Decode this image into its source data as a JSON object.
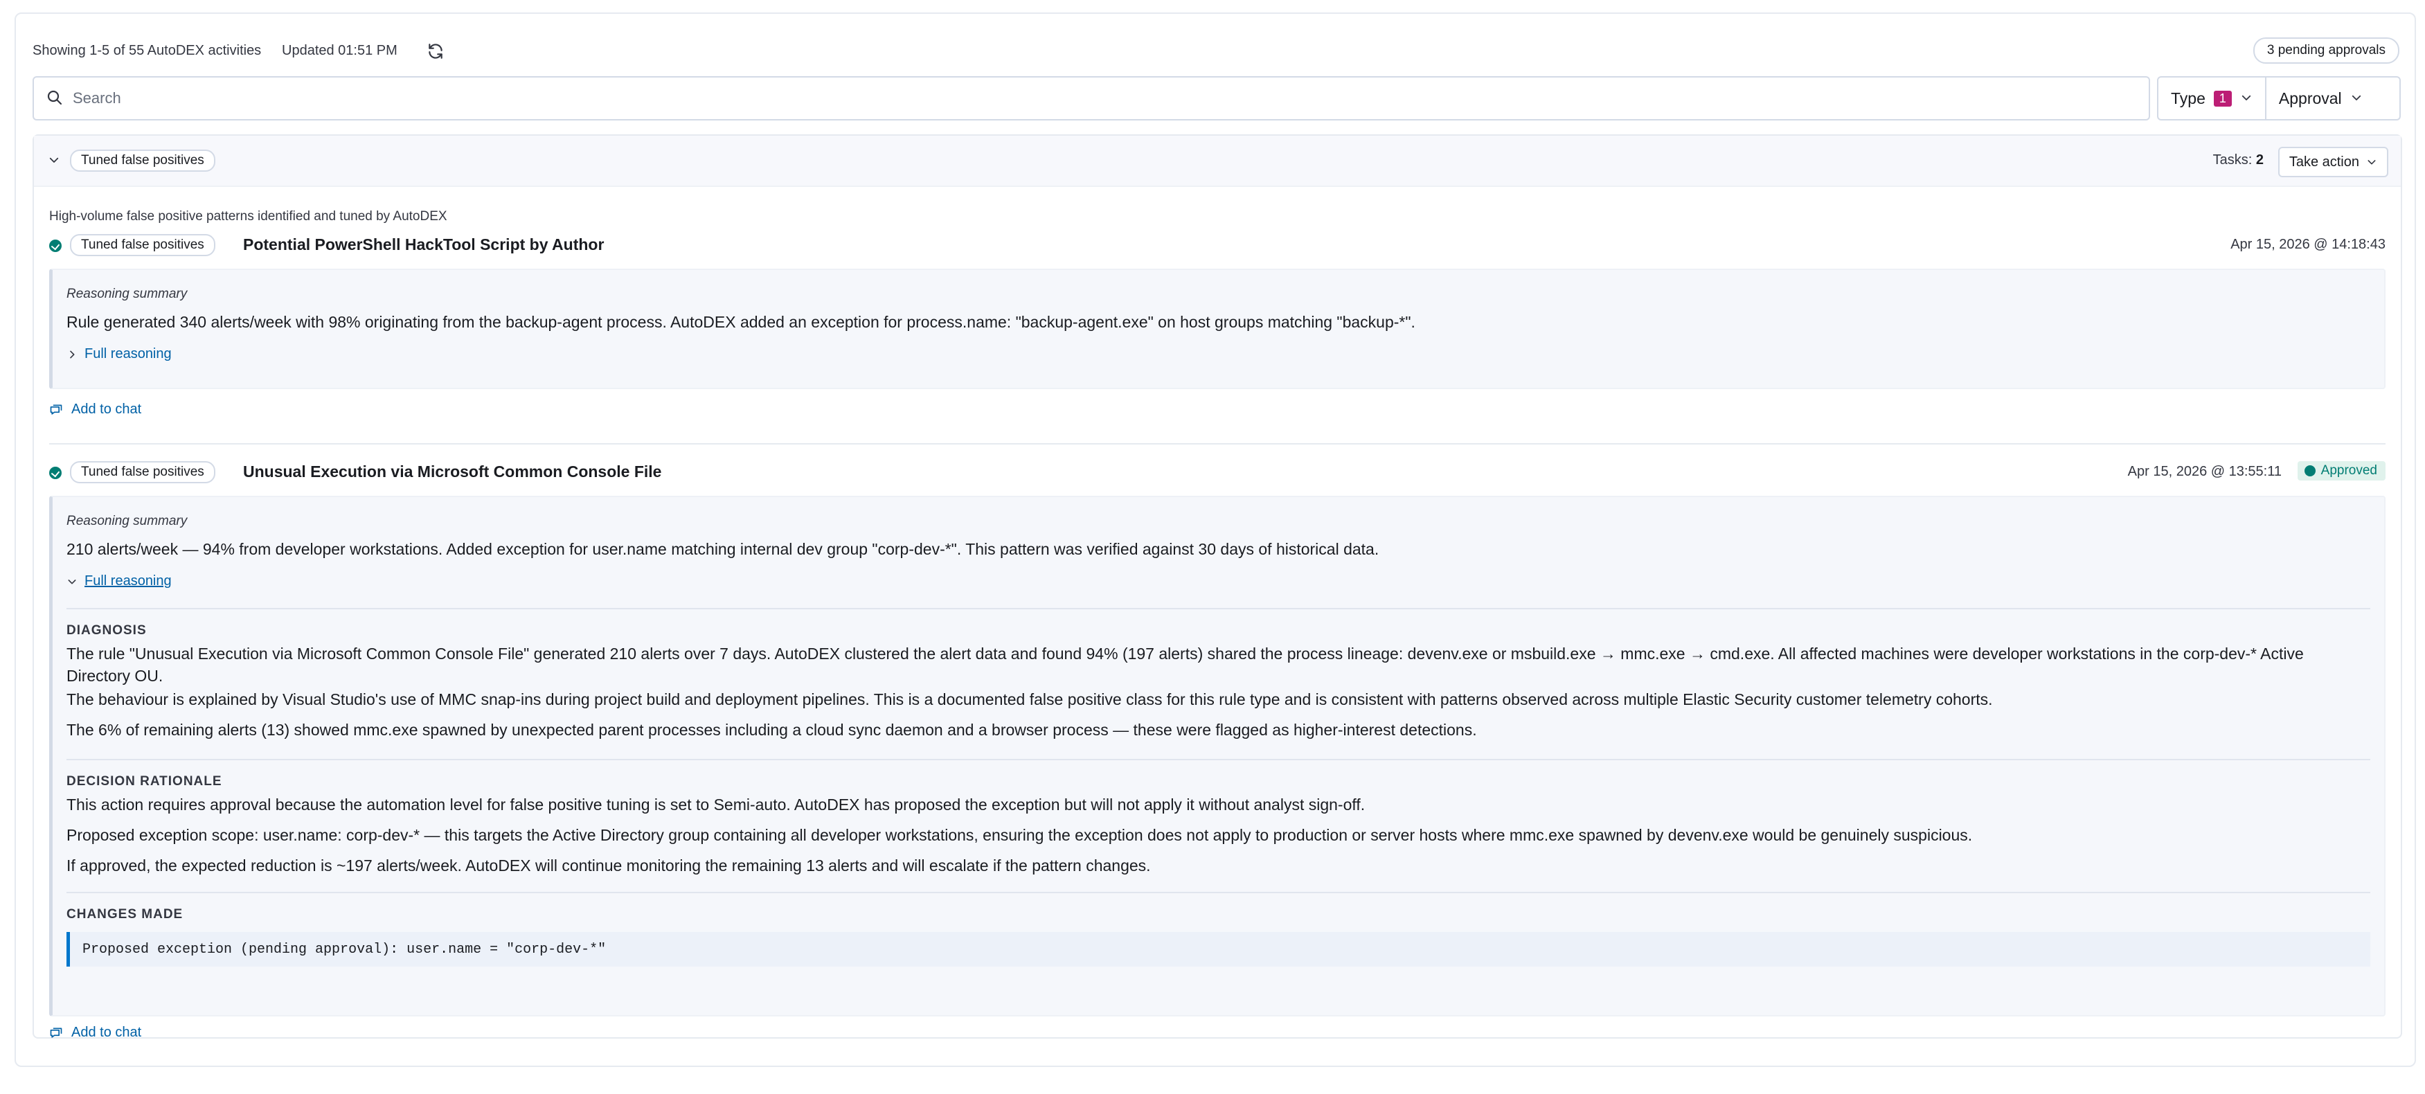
{
  "toolbar": {
    "count_text": "Showing 1-5 of 55 AutoDEX activities",
    "updated_text": "Updated 01:51 PM",
    "pending_text": "3 pending approvals"
  },
  "search": {
    "placeholder": "Search",
    "value": ""
  },
  "filters": {
    "type_label": "Type",
    "type_count": "1",
    "approval_label": "Approval"
  },
  "group": {
    "label": "Tuned false positives",
    "tasks_label": "Tasks:",
    "tasks_count": "2",
    "take_action_label": "Take action",
    "description": "High-volume false positive patterns identified and tuned by AutoDEX"
  },
  "items": [
    {
      "tag": "Tuned false positives",
      "title": "Potential PowerShell HackTool Script by Author",
      "timestamp": "Apr 15, 2026 @ 14:18:43",
      "reasoning_label": "Reasoning summary",
      "reasoning_text": "Rule generated 340 alerts/week with 98% originating from the backup-agent process. AutoDEX added an exception for process.name: \"backup-agent.exe\" on host groups matching \"backup-*\".",
      "full_reasoning_label": "Full reasoning",
      "add_to_chat_label": "Add to chat"
    },
    {
      "tag": "Tuned false positives",
      "title": "Unusual Execution via Microsoft Common Console File",
      "timestamp": "Apr 15, 2026 @ 13:55:11",
      "status": "Approved",
      "reasoning_label": "Reasoning summary",
      "reasoning_text": "210 alerts/week — 94% from developer workstations. Added exception for user.name matching internal dev group \"corp-dev-*\". This pattern was verified against 30 days of historical data.",
      "full_reasoning_label": "Full reasoning",
      "diagnosis_title": "DIAGNOSIS",
      "diagnosis": [
        "The rule \"Unusual Execution via Microsoft Common Console File\" generated 210 alerts over 7 days. AutoDEX clustered the alert data and found 94% (197 alerts) shared the process lineage: devenv.exe or msbuild.exe → mmc.exe → cmd.exe. All affected machines were developer workstations in the corp-dev-* Active Directory OU.",
        "The behaviour is explained by Visual Studio's use of MMC snap-ins during project build and deployment pipelines. This is a documented false positive class for this rule type and is consistent with patterns observed across multiple Elastic Security customer telemetry cohorts.",
        "The 6% of remaining alerts (13) showed mmc.exe spawned by unexpected parent processes including a cloud sync daemon and a browser process — these were flagged as higher-interest detections."
      ],
      "rationale_title": "DECISION RATIONALE",
      "rationale": [
        "This action requires approval because the automation level for false positive tuning is set to Semi-auto. AutoDEX has proposed the exception but will not apply it without analyst sign-off.",
        "Proposed exception scope: user.name: corp-dev-* — this targets the Active Directory group containing all developer workstations, ensuring the exception does not apply to production or server hosts where mmc.exe spawned by devenv.exe would be genuinely suspicious.",
        "If approved, the expected reduction is ~197 alerts/week. AutoDEX will continue monitoring the remaining 13 alerts and will escalate if the pattern changes."
      ],
      "changes_title": "CHANGES MADE",
      "changes_code": "Proposed exception (pending approval): user.name = \"corp-dev-*\"",
      "add_to_chat_label": "Add to chat"
    }
  ],
  "colors": {
    "accent": "#bc1e75",
    "link": "#0061a6",
    "success": "#017d73",
    "code_border": "#0077cc"
  },
  "icons": [
    "refresh-icon",
    "search-icon",
    "chevron-down-icon",
    "chevron-right-icon",
    "check-circle-icon",
    "chat-icon"
  ]
}
